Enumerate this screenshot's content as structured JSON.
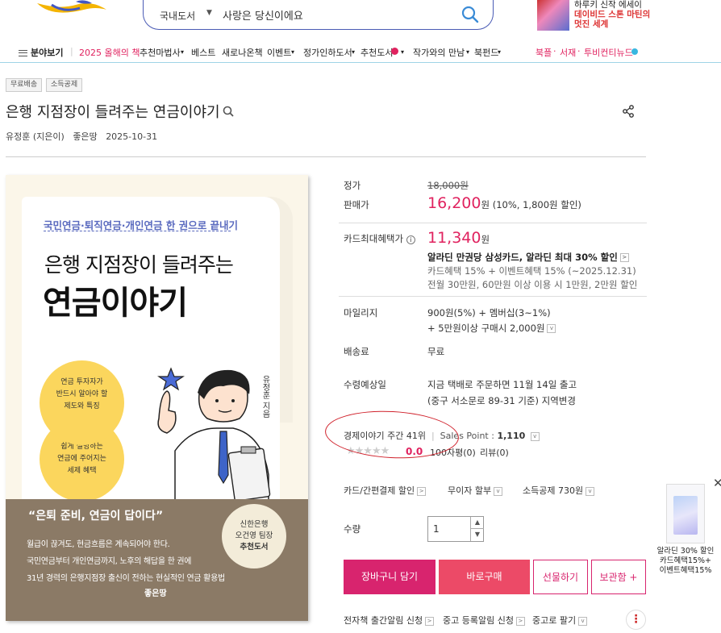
{
  "header": {
    "search": {
      "category": "국내도서",
      "query": "사랑은 당신이에요"
    },
    "ad": {
      "line1": "하루키 신작 에세이",
      "line2": "데이비드 스톤 마틴의",
      "line3": "멋진 세계"
    }
  },
  "nav": {
    "field_view": "분야보기",
    "items": [
      "2025 올해의 책",
      "추천마법사",
      "베스트",
      "새로나온책",
      "이벤트",
      "정가인하도서",
      "추천도서",
      "작가와의 만남",
      "북펀드"
    ],
    "right": [
      "북플",
      "서재",
      "투비컨티뉴드"
    ]
  },
  "product": {
    "tags": [
      "무료배송",
      "소득공제"
    ],
    "title": "은행 지점장이 들려주는 연금이야기",
    "author": "유정훈 (지은이)",
    "publisher": "좋은땅",
    "date": "2025-10-31",
    "cover": {
      "subtitle": "국민연금·퇴직연금·개인연금 한 권으로 끝내기",
      "title_line1": "은행 지점장이 들려주는",
      "title_line2": "연금이야기",
      "bubble1": [
        "연금 투자자가",
        "반드시 알아야 할",
        "제도와 특징"
      ],
      "bubble2": [
        "쉽게 설명하는",
        "연금에 주어지는",
        "세제 혜택"
      ],
      "author": "유정훈 지음",
      "quote": "“은퇴 준비, 연금이 답이다”",
      "desc": [
        "월급이 끊겨도, 현금흐름은 계속되어야 한다.",
        "국민연금부터 개인연금까지, 노후의 해답을 한 권에",
        "31년 경력의 은행지점장 출신이 전하는 현실적인 연금 활용법"
      ],
      "seal": [
        "신한은행",
        "오건영 팀장",
        "추천도서"
      ],
      "publisher": "좋은땅"
    }
  },
  "price": {
    "list_label": "정가",
    "list_price": "18,000원",
    "sale_label": "판매가",
    "sale_price": "16,200",
    "sale_unit": "원",
    "sale_note": "(10%, 1,800원 할인)",
    "card_label": "카드최대혜택가",
    "card_price": "11,340",
    "card_unit": "원",
    "card_line1": "알라딘 만권당 삼성카드, 알라딘 최대 30% 할인",
    "card_line2": "카드혜택 15% + 이벤트혜택 15% (~2025.12.31)",
    "card_line3": "전월 30만원, 60만원 이상 이용 시 1만원, 2만원 할인",
    "mileage_label": "마일리지",
    "mileage_line1": "900원(5%) + 멤버십(3~1%)",
    "mileage_line2": "+ 5만원이상 구매시 2,000원",
    "shipping_label": "배송료",
    "shipping_value": "무료",
    "arrival_label": "수령예상일",
    "arrival_line1": "지금 택배로 주문하면 11월 14일 출고",
    "arrival_line2": "(중구 서소문로 89-31 기준) 지역변경",
    "rank": "경제이야기 주간 41위",
    "sales_point_label": "Sales Point :",
    "sales_point": "1,110",
    "rating": "0.0",
    "reviews": "100자평(0)",
    "review": "리뷰(0)",
    "opt1": "카드/간편결제 할인",
    "opt2": "무이자 할부",
    "opt3": "소득공제 730원",
    "qty_label": "수량",
    "qty_value": "1"
  },
  "buttons": {
    "cart": "장바구니 담기",
    "buy": "바로구매",
    "gift": "선물하기",
    "keep": "보관함 +"
  },
  "footer_links": [
    "전자책 출간알림 신청",
    "중고 등록알림 신청",
    "중고로 팔기"
  ],
  "side_ad": {
    "line1": "알라딘 30% 할인",
    "line2": "카드혜택15%+",
    "line3": "이벤트혜택15%"
  },
  "colors": {
    "accent": "#e0225f",
    "cart": "#d8246e",
    "buy": "#ec4a67",
    "annotation": "#d0202a"
  }
}
